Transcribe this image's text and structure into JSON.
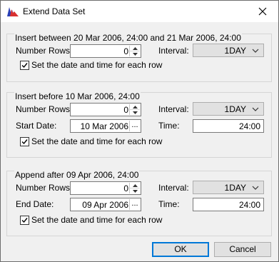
{
  "window": {
    "title": "Extend Data Set"
  },
  "colors": {
    "accent": "#0078d7",
    "icon_red": "#d93030",
    "icon_blue": "#2a3fb5"
  },
  "insert_between": {
    "group_label": "Insert between 20 Mar 2006, 24:00 and 21 Mar 2006, 24:00",
    "number_rows_label": "Number Rows:",
    "number_rows_value": "0",
    "interval_label": "Interval:",
    "interval_value": "1DAY",
    "checkbox_label": "Set the date and time for each row",
    "checkbox_checked": true
  },
  "insert_before": {
    "group_label": "Insert before 10 Mar 2006, 24:00",
    "number_rows_label": "Number Rows:",
    "number_rows_value": "0",
    "interval_label": "Interval:",
    "interval_value": "1DAY",
    "start_date_label": "Start Date:",
    "start_date_value": "10 Mar 2006",
    "time_label": "Time:",
    "time_value": "24:00",
    "checkbox_label": "Set the date and time for each row",
    "checkbox_checked": true
  },
  "append_after": {
    "group_label": "Append after 09 Apr 2006, 24:00",
    "number_rows_label": "Number Rows:",
    "number_rows_value": "0",
    "interval_label": "Interval:",
    "interval_value": "1DAY",
    "end_date_label": "End Date:",
    "end_date_value": "09 Apr 2006",
    "time_label": "Time:",
    "time_value": "24:00",
    "checkbox_label": "Set the date and time for each row",
    "checkbox_checked": true
  },
  "buttons": {
    "ok": "OK",
    "cancel": "Cancel",
    "ellipsis": "..."
  },
  "icons": {
    "app": "chart-app-icon",
    "close": "close-icon",
    "spin_up": "spin-up-icon",
    "spin_down": "spin-down-icon",
    "dropdown": "chevron-down-icon",
    "check": "checkmark-icon"
  }
}
